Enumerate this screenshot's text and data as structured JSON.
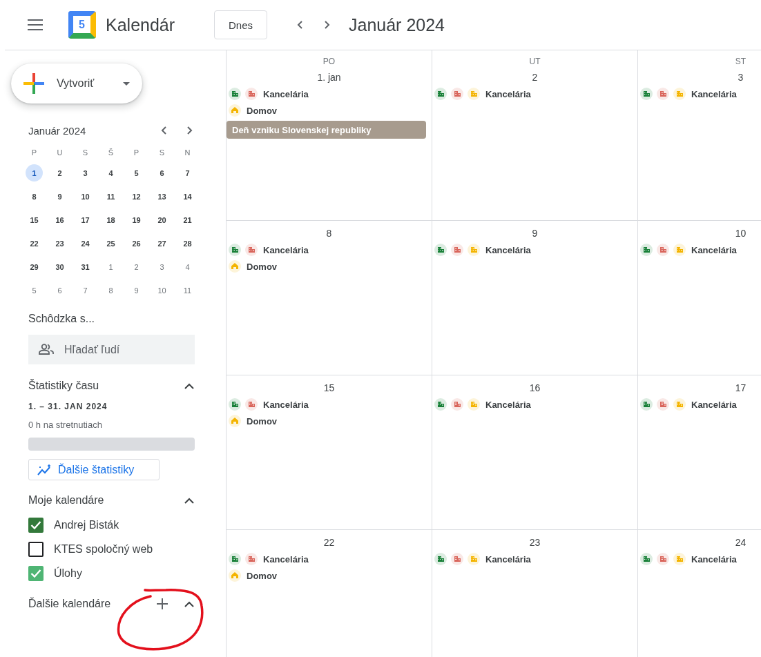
{
  "header": {
    "logo_text": "5",
    "app_name": "Kalendár",
    "today_button": "Dnes",
    "period_title": "Január 2024"
  },
  "sidebar": {
    "create_button": "Vytvoriť",
    "mini_calendar": {
      "title": "Január 2024",
      "weekdays": [
        "P",
        "U",
        "S",
        "Š",
        "P",
        "S",
        "N"
      ],
      "weeks": [
        [
          {
            "day": "1",
            "other_month": false,
            "selected": true
          },
          {
            "day": "2",
            "other_month": false,
            "selected": false
          },
          {
            "day": "3",
            "other_month": false,
            "selected": false
          },
          {
            "day": "4",
            "other_month": false,
            "selected": false
          },
          {
            "day": "5",
            "other_month": false,
            "selected": false
          },
          {
            "day": "6",
            "other_month": false,
            "selected": false
          },
          {
            "day": "7",
            "other_month": false,
            "selected": false
          }
        ],
        [
          {
            "day": "8",
            "other_month": false,
            "selected": false
          },
          {
            "day": "9",
            "other_month": false,
            "selected": false
          },
          {
            "day": "10",
            "other_month": false,
            "selected": false
          },
          {
            "day": "11",
            "other_month": false,
            "selected": false
          },
          {
            "day": "12",
            "other_month": false,
            "selected": false
          },
          {
            "day": "13",
            "other_month": false,
            "selected": false
          },
          {
            "day": "14",
            "other_month": false,
            "selected": false
          }
        ],
        [
          {
            "day": "15",
            "other_month": false,
            "selected": false
          },
          {
            "day": "16",
            "other_month": false,
            "selected": false
          },
          {
            "day": "17",
            "other_month": false,
            "selected": false
          },
          {
            "day": "18",
            "other_month": false,
            "selected": false
          },
          {
            "day": "19",
            "other_month": false,
            "selected": false
          },
          {
            "day": "20",
            "other_month": false,
            "selected": false
          },
          {
            "day": "21",
            "other_month": false,
            "selected": false
          }
        ],
        [
          {
            "day": "22",
            "other_month": false,
            "selected": false
          },
          {
            "day": "23",
            "other_month": false,
            "selected": false
          },
          {
            "day": "24",
            "other_month": false,
            "selected": false
          },
          {
            "day": "25",
            "other_month": false,
            "selected": false
          },
          {
            "day": "26",
            "other_month": false,
            "selected": false
          },
          {
            "day": "27",
            "other_month": false,
            "selected": false
          },
          {
            "day": "28",
            "other_month": false,
            "selected": false
          }
        ],
        [
          {
            "day": "29",
            "other_month": false,
            "selected": false
          },
          {
            "day": "30",
            "other_month": false,
            "selected": false
          },
          {
            "day": "31",
            "other_month": false,
            "selected": false
          },
          {
            "day": "1",
            "other_month": true,
            "selected": false
          },
          {
            "day": "2",
            "other_month": true,
            "selected": false
          },
          {
            "day": "3",
            "other_month": true,
            "selected": false
          },
          {
            "day": "4",
            "other_month": true,
            "selected": false
          }
        ],
        [
          {
            "day": "5",
            "other_month": true,
            "selected": false
          },
          {
            "day": "6",
            "other_month": true,
            "selected": false
          },
          {
            "day": "7",
            "other_month": true,
            "selected": false
          },
          {
            "day": "8",
            "other_month": true,
            "selected": false
          },
          {
            "day": "9",
            "other_month": true,
            "selected": false
          },
          {
            "day": "10",
            "other_month": true,
            "selected": false
          },
          {
            "day": "11",
            "other_month": true,
            "selected": false
          }
        ]
      ]
    },
    "meet_with": {
      "title": "Schôdzka s...",
      "search": {
        "placeholder": "Hľadať ľudí"
      }
    },
    "time_insights": {
      "title": "Štatistiky času",
      "expanded": true,
      "range": "1. – 31. JAN 2024",
      "summary": "0 h na stretnutiach",
      "button": "Ďalšie štatistiky"
    },
    "my_calendars": {
      "title": "Moje kalendáre",
      "expanded": true,
      "items": [
        {
          "name": "Andrej Bisták",
          "checked": true,
          "color": "#33793b"
        },
        {
          "name": "KTES spoločný web",
          "checked": false
        },
        {
          "name": "Úlohy",
          "checked": true,
          "color": "#4fb574"
        }
      ]
    },
    "other_calendars": {
      "title": "Ďalšie kalendáre",
      "expanded": true
    }
  },
  "grid": {
    "weekdays": [
      "PO",
      "UT",
      "ST"
    ],
    "weeks": [
      {
        "days": [
          {
            "label": "1. jan",
            "events": [
              {
                "kind": "office",
                "label": "Kancelária",
                "markers": [
                  {
                    "color": "#188038"
                  },
                  {
                    "color": "#d9655b"
                  }
                ]
              },
              {
                "kind": "home",
                "label": "Domov",
                "color": "#f4b400"
              },
              {
                "kind": "holiday",
                "label": "Deň vzniku Slovenskej republiky",
                "color": "#a79b8e"
              }
            ]
          },
          {
            "label": "2",
            "events": [
              {
                "kind": "office",
                "label": "Kancelária",
                "markers": [
                  {
                    "color": "#188038"
                  },
                  {
                    "color": "#d9655b"
                  },
                  {
                    "color": "#f4b400"
                  }
                ]
              }
            ]
          },
          {
            "label": "3",
            "events": [
              {
                "kind": "office",
                "label": "Kancelária",
                "markers": [
                  {
                    "color": "#188038"
                  },
                  {
                    "color": "#d9655b"
                  },
                  {
                    "color": "#f4b400"
                  }
                ]
              }
            ]
          }
        ]
      },
      {
        "days": [
          {
            "label": "8",
            "events": [
              {
                "kind": "office",
                "label": "Kancelária",
                "markers": [
                  {
                    "color": "#188038"
                  },
                  {
                    "color": "#d9655b"
                  }
                ]
              },
              {
                "kind": "home",
                "label": "Domov",
                "color": "#f4b400"
              }
            ]
          },
          {
            "label": "9",
            "events": [
              {
                "kind": "office",
                "label": "Kancelária",
                "markers": [
                  {
                    "color": "#188038"
                  },
                  {
                    "color": "#d9655b"
                  },
                  {
                    "color": "#f4b400"
                  }
                ]
              }
            ]
          },
          {
            "label": "10",
            "events": [
              {
                "kind": "office",
                "label": "Kancelária",
                "markers": [
                  {
                    "color": "#188038"
                  },
                  {
                    "color": "#d9655b"
                  },
                  {
                    "color": "#f4b400"
                  }
                ]
              }
            ]
          }
        ]
      },
      {
        "days": [
          {
            "label": "15",
            "events": [
              {
                "kind": "office",
                "label": "Kancelária",
                "markers": [
                  {
                    "color": "#188038"
                  },
                  {
                    "color": "#d9655b"
                  }
                ]
              },
              {
                "kind": "home",
                "label": "Domov",
                "color": "#f4b400"
              }
            ]
          },
          {
            "label": "16",
            "events": [
              {
                "kind": "office",
                "label": "Kancelária",
                "markers": [
                  {
                    "color": "#188038"
                  },
                  {
                    "color": "#d9655b"
                  },
                  {
                    "color": "#f4b400"
                  }
                ]
              }
            ]
          },
          {
            "label": "17",
            "events": [
              {
                "kind": "office",
                "label": "Kancelária",
                "markers": [
                  {
                    "color": "#188038"
                  },
                  {
                    "color": "#d9655b"
                  },
                  {
                    "color": "#f4b400"
                  }
                ]
              }
            ]
          }
        ]
      },
      {
        "days": [
          {
            "label": "22",
            "events": [
              {
                "kind": "office",
                "label": "Kancelária",
                "markers": [
                  {
                    "color": "#188038"
                  },
                  {
                    "color": "#d9655b"
                  }
                ]
              },
              {
                "kind": "home",
                "label": "Domov",
                "color": "#f4b400"
              }
            ]
          },
          {
            "label": "23",
            "events": [
              {
                "kind": "office",
                "label": "Kancelária",
                "markers": [
                  {
                    "color": "#188038"
                  },
                  {
                    "color": "#d9655b"
                  },
                  {
                    "color": "#f4b400"
                  }
                ]
              }
            ]
          },
          {
            "label": "24",
            "events": [
              {
                "kind": "office",
                "label": "Kancelária",
                "markers": [
                  {
                    "color": "#188038"
                  },
                  {
                    "color": "#d9655b"
                  },
                  {
                    "color": "#f4b400"
                  }
                ]
              }
            ]
          }
        ]
      }
    ]
  }
}
